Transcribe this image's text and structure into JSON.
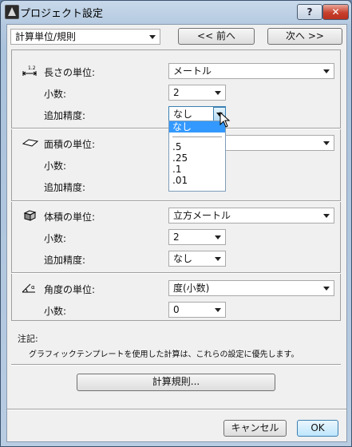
{
  "window": {
    "title": "プロジェクト設定",
    "help_label": "?",
    "close_label": "✕"
  },
  "nav": {
    "category": "計算単位/規則",
    "prev_label": "<< 前へ",
    "next_label": "次へ >>"
  },
  "length": {
    "label": "長さの単位:",
    "unit": "メートル",
    "decimals_label": "小数:",
    "decimals": "2",
    "precision_label": "追加精度:",
    "precision": "なし"
  },
  "area": {
    "label": "面積の単位:",
    "decimals_label": "小数:",
    "precision_label": "追加精度:"
  },
  "volume": {
    "label": "体積の単位:",
    "unit": "立方メートル",
    "decimals_label": "小数:",
    "decimals": "2",
    "precision_label": "追加精度:",
    "precision": "なし"
  },
  "angle": {
    "label": "角度の単位:",
    "unit": "度(小数)",
    "decimals_label": "小数:",
    "decimals": "0"
  },
  "precision_dropdown": {
    "options": [
      "なし",
      ".5",
      ".25",
      ".1",
      ".01"
    ],
    "selected_index": 0
  },
  "note": {
    "title": "注記:",
    "text": "グラフィックテンプレートを使用した計算は、これらの設定に優先します。"
  },
  "rules_button": "計算規則...",
  "footer": {
    "cancel_label": "キャンセル",
    "ok_label": "OK"
  },
  "icons": {
    "length": "ruler-length-icon",
    "area": "area-plane-icon",
    "volume": "volume-cube-icon",
    "angle": "angle-icon"
  }
}
